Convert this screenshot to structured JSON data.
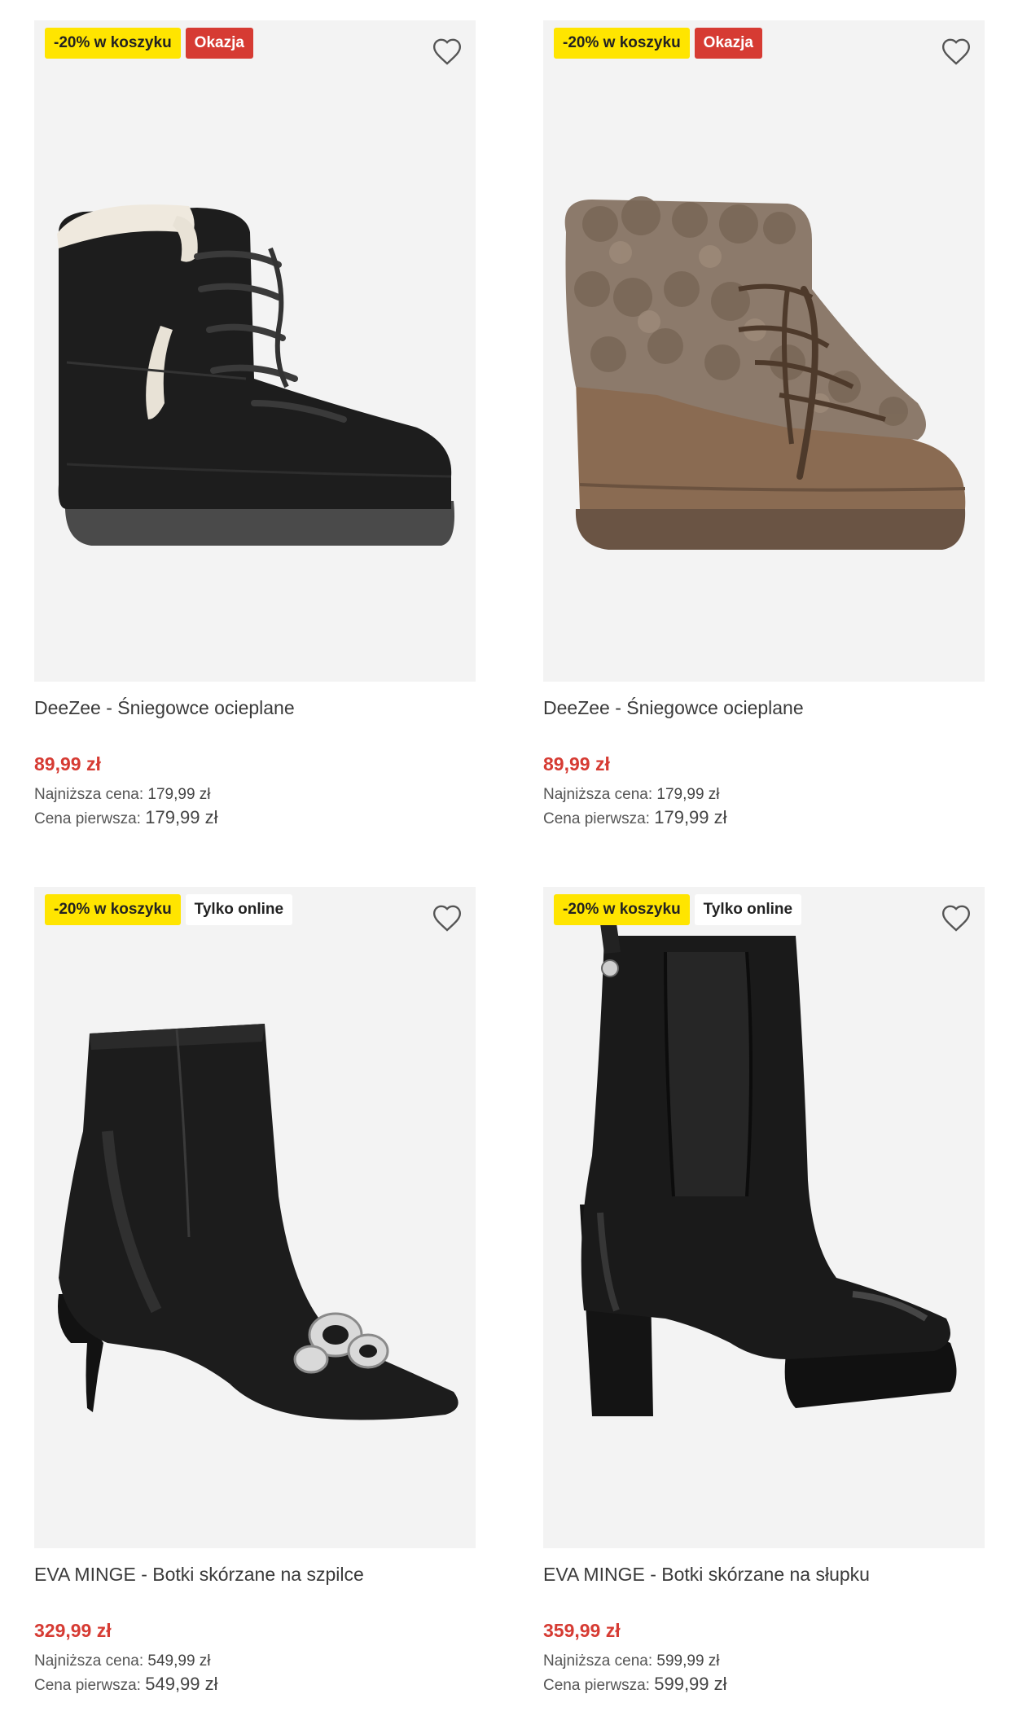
{
  "products": [
    {
      "badges": {
        "promo": "-20% w koszyku",
        "tag": "Okazja"
      },
      "name": "DeeZee - Śniegowce ocieplane",
      "price": "89,99 zł",
      "lowest_label": "Najniższa cena:",
      "lowest_value": "179,99 zł",
      "first_label": "Cena pierwsza:",
      "first_value": "179,99 zł",
      "image_icon": "black-snow-boot",
      "wishlist_icon": "heart-outline-icon"
    },
    {
      "badges": {
        "promo": "-20% w koszyku",
        "tag": "Okazja"
      },
      "name": "DeeZee - Śniegowce ocieplane",
      "price": "89,99 zł",
      "lowest_label": "Najniższa cena:",
      "lowest_value": "179,99 zł",
      "first_label": "Cena pierwsza:",
      "first_value": "179,99 zł",
      "image_icon": "brown-fur-snow-boot",
      "wishlist_icon": "heart-outline-icon"
    },
    {
      "badges": {
        "promo": "-20% w koszyku",
        "tag": "Tylko online"
      },
      "name": "EVA MINGE - Botki skórzane na szpilce",
      "price": "329,99 zł",
      "lowest_label": "Najniższa cena:",
      "lowest_value": "549,99 zł",
      "first_label": "Cena pierwsza:",
      "first_value": "549,99 zł",
      "image_icon": "black-stiletto-ankle-boot",
      "wishlist_icon": "heart-outline-icon"
    },
    {
      "badges": {
        "promo": "-20% w koszyku",
        "tag": "Tylko online"
      },
      "name": "EVA MINGE - Botki skórzane na słupku",
      "price": "359,99 zł",
      "lowest_label": "Najniższa cena:",
      "lowest_value": "599,99 zł",
      "first_label": "Cena pierwsza:",
      "first_value": "599,99 zł",
      "image_icon": "black-block-heel-platform-boot",
      "wishlist_icon": "heart-outline-icon"
    }
  ],
  "colors": {
    "promo_badge": "#ffe500",
    "okazja_badge": "#d63b33",
    "price_red": "#d63b33",
    "image_bg": "#f3f3f3"
  }
}
